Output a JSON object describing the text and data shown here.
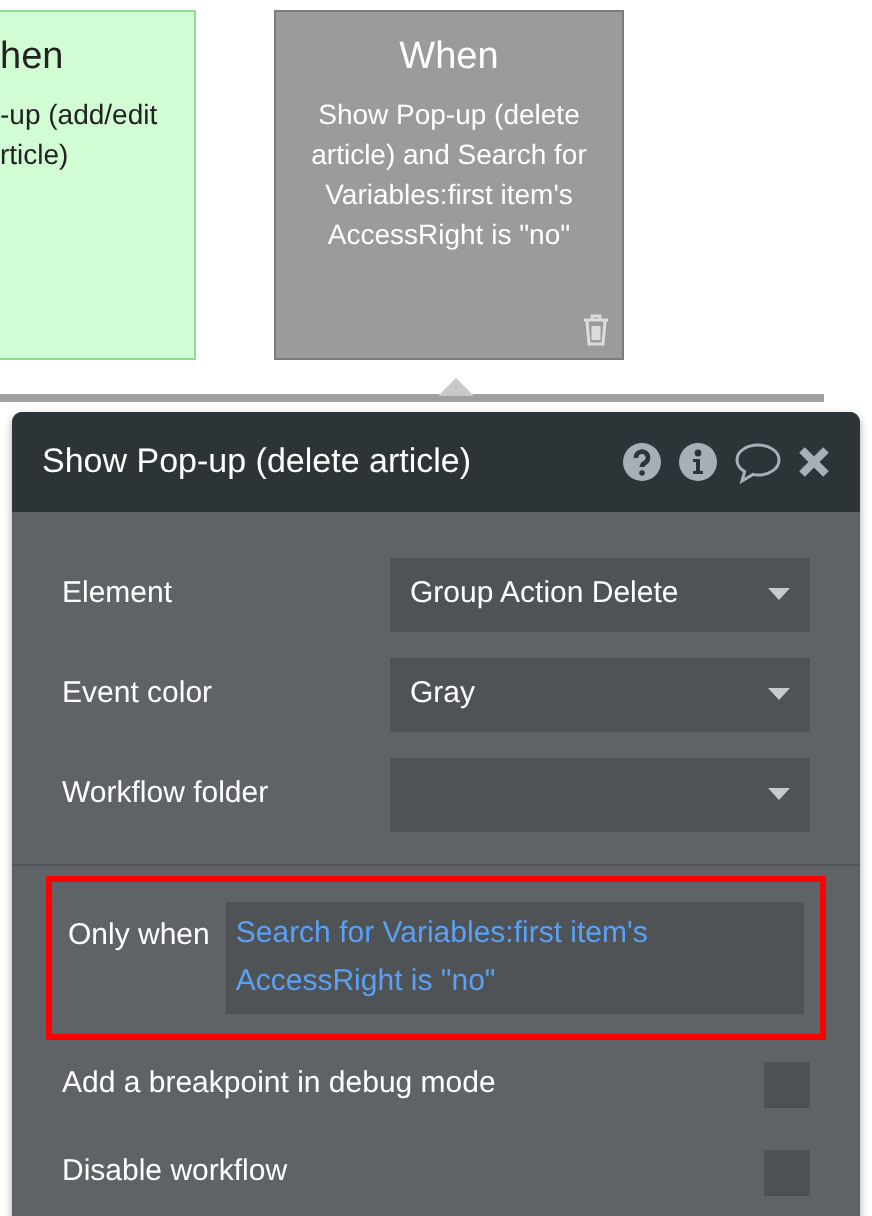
{
  "cards": [
    {
      "title": "hen",
      "lines": [
        "-up (add/edit",
        "rticle)"
      ],
      "color": "#d2fcd4",
      "has_delete": false
    },
    {
      "title": "When",
      "lines": [
        "Show Pop-up (delete",
        "article) and Search for",
        "Variables:first item's",
        "AccessRight is \"no\""
      ],
      "color": "#9b9b9b",
      "has_delete": true
    }
  ],
  "popup": {
    "title": "Show Pop-up (delete article)",
    "fields": [
      {
        "label": "Element",
        "kind": "dropdown",
        "value": "Group Action Delete"
      },
      {
        "label": "Event color",
        "kind": "dropdown",
        "value": "Gray"
      },
      {
        "label": "Workflow folder",
        "kind": "dropdown"
      }
    ],
    "condition": {
      "label": "Only when",
      "value": "Search for Variables:first item's AccessRight is \"no\"",
      "highlighted": true
    },
    "options": [
      {
        "label": "Add a breakpoint in debug mode",
        "checked": false
      },
      {
        "label": "Disable workflow",
        "checked": false
      }
    ]
  }
}
